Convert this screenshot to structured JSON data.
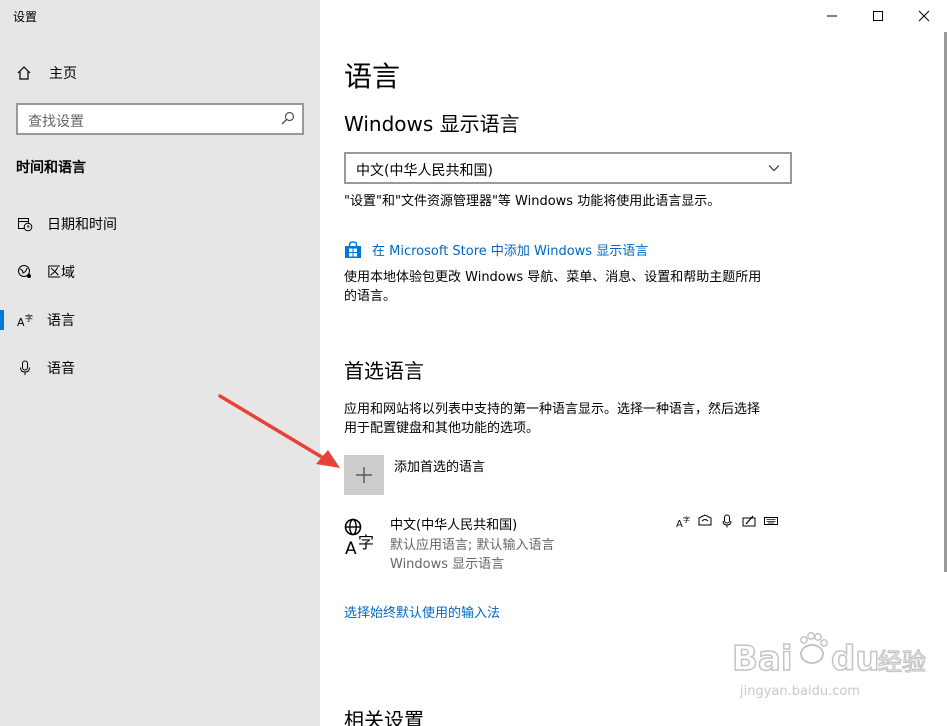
{
  "app": {
    "title": "设置"
  },
  "sidebar": {
    "home_label": "主页",
    "search_placeholder": "查找设置",
    "section_title": "时间和语言",
    "items": [
      {
        "label": "日期和时间",
        "icon": "calendar-clock-icon"
      },
      {
        "label": "区域",
        "icon": "globe-region-icon"
      },
      {
        "label": "语言",
        "icon": "language-icon",
        "active": true
      },
      {
        "label": "语音",
        "icon": "microphone-icon"
      }
    ]
  },
  "main": {
    "title": "语言",
    "display_language": {
      "heading": "Windows 显示语言",
      "selected": "中文(中华人民共和国)",
      "note": "\"设置\"和\"文件资源管理器\"等 Windows 功能将使用此语言显示。",
      "store_link": "在 Microsoft Store 中添加 Windows 显示语言",
      "store_desc_line1": "使用本地体验包更改 Windows 导航、菜单、消息、设置和帮助主题所用",
      "store_desc_line2": "的语言。"
    },
    "preferred": {
      "heading": "首选语言",
      "desc_line1": "应用和网站将以列表中支持的第一种语言显示。选择一种语言，然后选择",
      "desc_line2": "用于配置键盘和其他功能的选项。",
      "add_label": "添加首选的语言",
      "languages": [
        {
          "name": "中文(中华人民共和国)",
          "detail1": "默认应用语言; 默认输入语言",
          "detail2": "Windows 显示语言",
          "features": [
            "language-pack-icon",
            "speech-icon",
            "microphone-icon",
            "handwriting-icon",
            "keyboard-icon"
          ]
        }
      ],
      "input_link": "选择始终默认使用的输入法"
    },
    "related_heading": "相关设置"
  },
  "watermark": {
    "line1": "Bai",
    "line2": "du",
    "line3": "经验",
    "url": "jingyan.baidu.com"
  },
  "colors": {
    "accent": "#0078d7",
    "link": "#0067c0",
    "sidebar_bg": "#e6e6e6",
    "arrow": "#e8413a"
  }
}
